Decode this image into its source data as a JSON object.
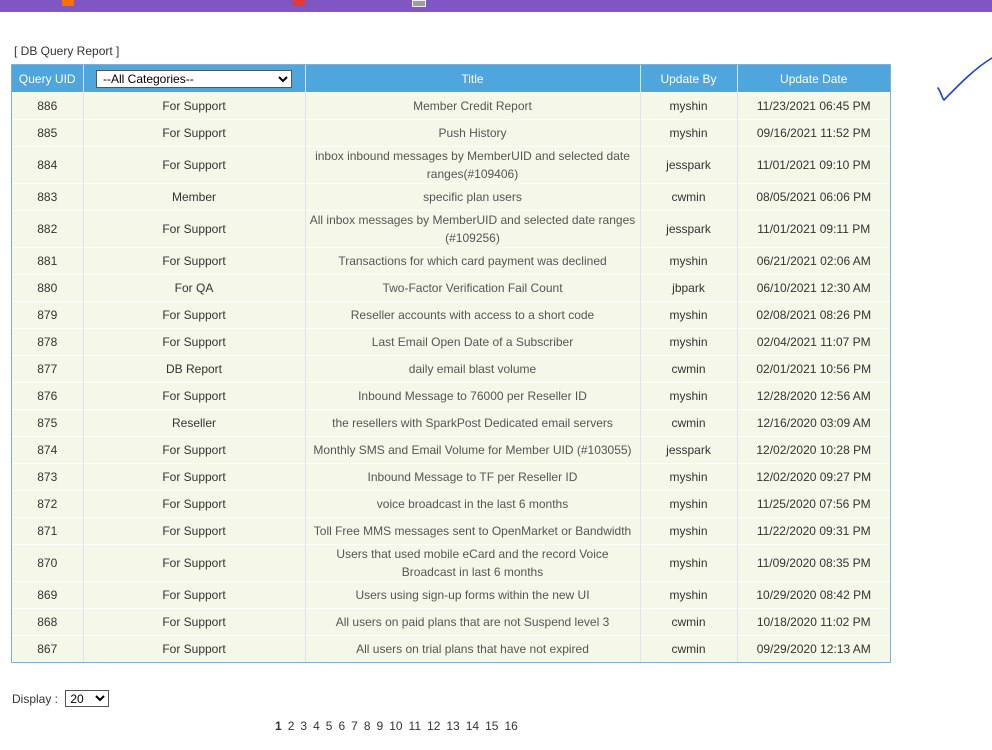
{
  "header": {
    "report_title": "[ DB Query Report ]"
  },
  "table": {
    "columns": {
      "query_uid": "Query UID",
      "category_selected": "--All Categories--",
      "title": "Title",
      "update_by": "Update By",
      "update_date": "Update Date"
    },
    "rows": [
      {
        "uid": "886",
        "category": "For Support",
        "title": "Member Credit Report",
        "by": "myshin",
        "date": "11/23/2021 06:45 PM"
      },
      {
        "uid": "885",
        "category": "For Support",
        "title": "Push History",
        "by": "myshin",
        "date": "09/16/2021 11:52 PM"
      },
      {
        "uid": "884",
        "category": "For Support",
        "title": "inbox inbound messages by MemberUID and selected date ranges(#109406)",
        "by": "jesspark",
        "date": "11/01/2021 09:10 PM"
      },
      {
        "uid": "883",
        "category": "Member",
        "title": "specific plan users",
        "by": "cwmin",
        "date": "08/05/2021 06:06 PM"
      },
      {
        "uid": "882",
        "category": "For Support",
        "title": "All inbox messages by MemberUID and selected date ranges (#109256)",
        "by": "jesspark",
        "date": "11/01/2021 09:11 PM"
      },
      {
        "uid": "881",
        "category": "For Support",
        "title": "Transactions for which card payment was declined",
        "by": "myshin",
        "date": "06/21/2021 02:06 AM"
      },
      {
        "uid": "880",
        "category": "For QA",
        "title": "Two-Factor Verification Fail Count",
        "by": "jbpark",
        "date": "06/10/2021 12:30 AM"
      },
      {
        "uid": "879",
        "category": "For Support",
        "title": "Reseller accounts with access to a short code",
        "by": "myshin",
        "date": "02/08/2021 08:26 PM"
      },
      {
        "uid": "878",
        "category": "For Support",
        "title": "Last Email Open Date of a Subscriber",
        "by": "myshin",
        "date": "02/04/2021 11:07 PM"
      },
      {
        "uid": "877",
        "category": "DB Report",
        "title": "daily email blast volume",
        "by": "cwmin",
        "date": "02/01/2021 10:56 PM"
      },
      {
        "uid": "876",
        "category": "For Support",
        "title": "Inbound Message to 76000 per Reseller ID",
        "by": "myshin",
        "date": "12/28/2020 12:56 AM"
      },
      {
        "uid": "875",
        "category": "Reseller",
        "title": "the resellers with SparkPost Dedicated email servers",
        "by": "cwmin",
        "date": "12/16/2020 03:09 AM"
      },
      {
        "uid": "874",
        "category": "For Support",
        "title": "Monthly SMS and Email Volume for Member UID (#103055)",
        "by": "jesspark",
        "date": "12/02/2020 10:28 PM"
      },
      {
        "uid": "873",
        "category": "For Support",
        "title": "Inbound Message to TF per Reseller ID",
        "by": "myshin",
        "date": "12/02/2020 09:27 PM"
      },
      {
        "uid": "872",
        "category": "For Support",
        "title": "voice broadcast in the last 6 months",
        "by": "myshin",
        "date": "11/25/2020 07:56 PM"
      },
      {
        "uid": "871",
        "category": "For Support",
        "title": "Toll Free MMS messages sent to OpenMarket or Bandwidth",
        "by": "myshin",
        "date": "11/22/2020 09:31 PM"
      },
      {
        "uid": "870",
        "category": "For Support",
        "title": "Users that used mobile eCard and the record Voice Broadcast in last 6 months",
        "by": "myshin",
        "date": "11/09/2020 08:35 PM"
      },
      {
        "uid": "869",
        "category": "For Support",
        "title": "Users using sign-up forms within the new UI",
        "by": "myshin",
        "date": "10/29/2020 08:42 PM"
      },
      {
        "uid": "868",
        "category": "For Support",
        "title": "All users on paid plans that are not Suspend level 3",
        "by": "cwmin",
        "date": "10/18/2020 11:02 PM"
      },
      {
        "uid": "867",
        "category": "For Support",
        "title": "All users on trial plans that have not expired",
        "by": "cwmin",
        "date": "09/29/2020 12:13 AM"
      }
    ]
  },
  "footer": {
    "display_label": "Display :",
    "display_value": "20",
    "pages": [
      "1",
      "2",
      "3",
      "4",
      "5",
      "6",
      "7",
      "8",
      "9",
      "10",
      "11",
      "12",
      "13",
      "14",
      "15",
      "16"
    ],
    "current_page": "1"
  },
  "colors": {
    "header_bar": "#7e57c2",
    "table_header": "#4ea6dc",
    "row_bg": "#f5f8e9"
  }
}
